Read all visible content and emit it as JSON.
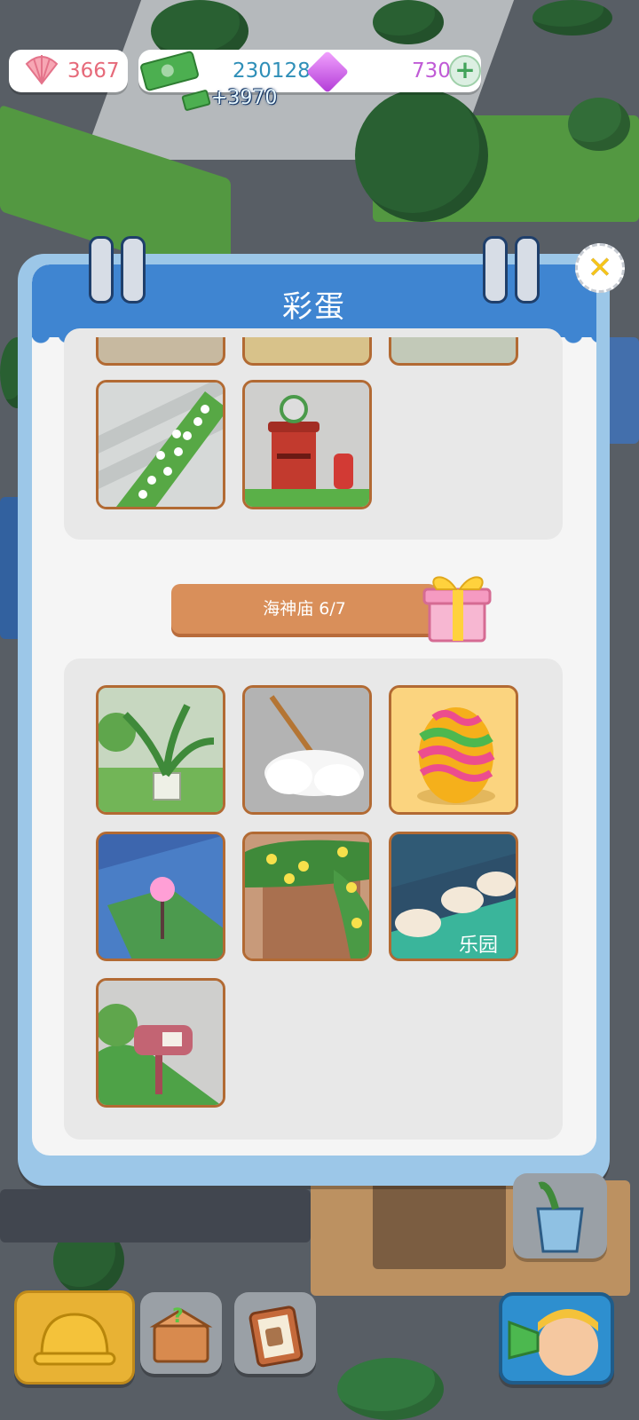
{
  "resources": {
    "shells": "3667",
    "cash": "230128",
    "gems": "730",
    "income": "+3970"
  },
  "dialog": {
    "title": "彩蛋",
    "group_label": "海神庙  6/7"
  },
  "colors": {
    "header_blue": "#3f85d1",
    "banner_orange": "#d98f5a",
    "tile_border": "#b26a33",
    "shell_text": "#e66a7a",
    "cash_text": "#2f8fb8",
    "gem_text": "#c05bd6"
  },
  "icons": [
    "shell-icon",
    "cash-icon",
    "gem-icon",
    "plus-icon",
    "close-icon",
    "gift-icon",
    "hardhat-icon",
    "toolbox-icon",
    "clipboard-icon",
    "megaphone-icon"
  ]
}
